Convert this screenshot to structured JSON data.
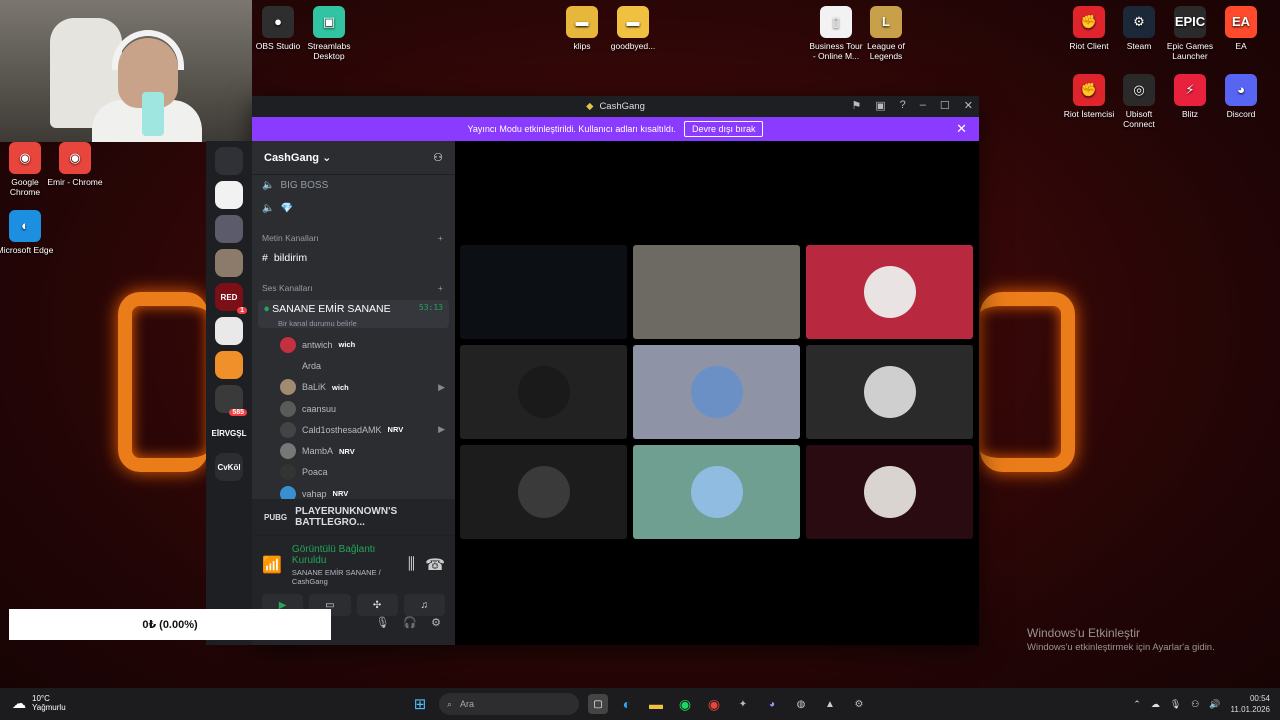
{
  "desktop": {
    "icons_left_top": [
      {
        "label": "OBS Studio",
        "glyph": "●",
        "bg": "#2e2e2e"
      },
      {
        "label": "Streamlabs Desktop",
        "glyph": "▣",
        "bg": "#31c3a2"
      }
    ],
    "icons_left": [
      {
        "label": "Google Chrome",
        "glyph": "◉",
        "bg": "#e8453c"
      },
      {
        "label": "Emir - Chrome",
        "glyph": "◉",
        "bg": "#e8453c"
      },
      {
        "label": "Microsoft Edge",
        "glyph": "◐",
        "bg": "#1d8fe1"
      }
    ],
    "icons_mid": [
      {
        "label": "klips",
        "glyph": "▬",
        "bg": "#e7b73b"
      },
      {
        "label": "goodbyed...",
        "glyph": "▬",
        "bg": "#f0c140"
      },
      {
        "label": "Business Tour - Online M...",
        "glyph": "▯",
        "bg": "#f2f2f2"
      },
      {
        "label": "League of Legends",
        "glyph": "L",
        "bg": "#c8a04a"
      }
    ],
    "icons_right": [
      {
        "label": "Riot Client",
        "glyph": "✊",
        "bg": "#e0242b"
      },
      {
        "label": "Steam",
        "glyph": "⚙",
        "bg": "#1b2838"
      },
      {
        "label": "Epic Games Launcher",
        "glyph": "EPIC",
        "bg": "#2a2a2a"
      },
      {
        "label": "EA",
        "glyph": "EA",
        "bg": "#ff4b2b"
      },
      {
        "label": "Riot İstemcisi",
        "glyph": "✊",
        "bg": "#e0242b"
      },
      {
        "label": "Ubisoft Connect",
        "glyph": "◎",
        "bg": "#2a2a2a"
      },
      {
        "label": "Blitz",
        "glyph": "⚡",
        "bg": "#e8213d"
      },
      {
        "label": "Discord",
        "glyph": "◕",
        "bg": "#5865f2"
      }
    ]
  },
  "window": {
    "title": "CashGang",
    "banner_text": "Yayıncı Modu etkinleştirildi. Kullanıcı adları kısaltıldı.",
    "banner_button": "Devre dışı bırak"
  },
  "servers": [
    {
      "label": "",
      "bg": "#2f3136"
    },
    {
      "label": "",
      "bg": "#f2f2f2"
    },
    {
      "label": "",
      "bg": "#5b5b6b"
    },
    {
      "label": "",
      "bg": "#8c7a6a"
    },
    {
      "label": "RED",
      "bg": "#7a0f18",
      "badge": "1"
    },
    {
      "label": "",
      "bg": "#e9e9e9"
    },
    {
      "label": "",
      "bg": "#f0902a"
    },
    {
      "label": "",
      "bg": "#3a3a3a",
      "badge": "585"
    },
    {
      "label": "EİRVGŞL",
      "bg": "#1e1f22"
    },
    {
      "label": "CvKöl",
      "bg": "#2b2d31"
    }
  ],
  "sidebar": {
    "server_name": "CashGang",
    "channels_top": [
      {
        "label": "BIG BOSS"
      },
      {
        "label": "💎"
      }
    ],
    "text_category": "Metin Kanalları",
    "text_channel": "bildirim",
    "voice_category": "Ses Kanalları",
    "active_voice": "SANANE EMİR SANANE",
    "active_timer": "53:13",
    "status_hint": "Bir kanal durumu belirle",
    "members": [
      {
        "name": "antwich",
        "tag": "wich",
        "color": "#c4303f"
      },
      {
        "name": "Arda",
        "tag": "",
        "color": "#2b2d31"
      },
      {
        "name": "BaLiK",
        "tag": "wich",
        "color": "#a08a70",
        "cam": true
      },
      {
        "name": "caansuu",
        "tag": "",
        "color": "#5a5a5a"
      },
      {
        "name": "Cald1osthesadAMK",
        "tag": "NRV",
        "color": "#444",
        "cam": true
      },
      {
        "name": "MambA",
        "tag": "NRV",
        "color": "#777"
      },
      {
        "name": "Poaca",
        "tag": "",
        "color": "#333"
      },
      {
        "name": "vahap",
        "tag": "NRV",
        "color": "#3a8fd0"
      }
    ],
    "activity": "PLAYERUNKNOWN'S BATTLEGRO...",
    "voice_status": "Görüntülü Bağlantı Kuruldu",
    "voice_sub": "SANANE EMİR SANANE / CashGang"
  },
  "stage": {
    "tiles": [
      {
        "kind": "video",
        "bg": "#0c1015"
      },
      {
        "kind": "video",
        "bg": "#6d6a63"
      },
      {
        "kind": "avatar",
        "bg": "#b8293f",
        "avatar": "#e9e3e3"
      },
      {
        "kind": "avatar",
        "bg": "#222222",
        "avatar": "#1a1a1a"
      },
      {
        "kind": "avatar",
        "bg": "#8e93a6",
        "avatar": "#6a90c6"
      },
      {
        "kind": "avatar",
        "bg": "#2a2a2a",
        "avatar": "#cfcfcf"
      },
      {
        "kind": "avatar",
        "bg": "#1c1c1c",
        "avatar": "#3a3a3a"
      },
      {
        "kind": "avatar",
        "bg": "#6e9f90",
        "avatar": "#8fbce0"
      },
      {
        "kind": "avatar",
        "bg": "#2a0b12",
        "avatar": "#d9d4cf"
      }
    ]
  },
  "overlay": {
    "donation": "0₺ (0.00%)"
  },
  "activation": {
    "title": "Windows'u Etkinleştir",
    "subtitle": "Windows'u etkinleştirmek için Ayarlar'a gidin."
  },
  "taskbar": {
    "temp": "10°C",
    "weather": "Yağmurlu",
    "search_placeholder": "Ara",
    "time": "00:54",
    "date": "11.01.2026"
  }
}
